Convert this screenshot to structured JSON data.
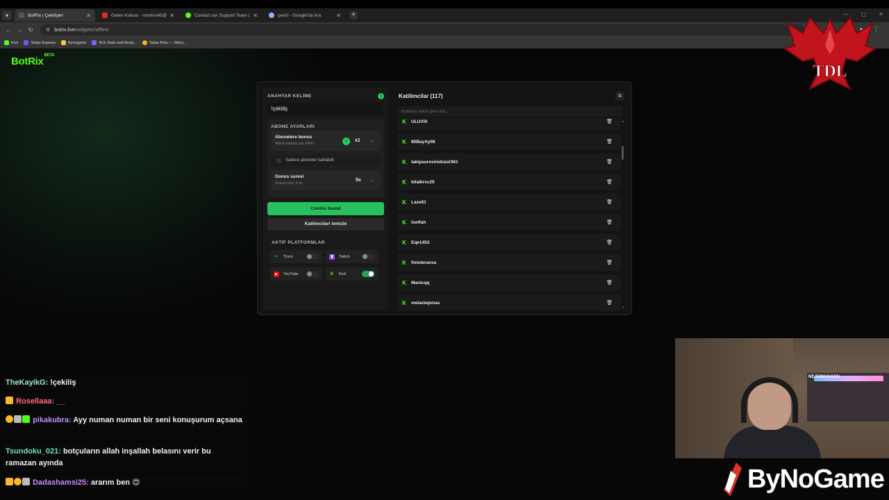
{
  "browser": {
    "tabs": [
      {
        "title": "BotRix | Çekilişler",
        "favicon_color": "#3a3a3a",
        "active": true
      },
      {
        "title": "Gelen Kutusu - nmnino45@gm",
        "favicon_color": "#d93025",
        "active": false
      },
      {
        "title": "Contact our Support Team | Ki",
        "favicon_color": "#53fc18",
        "active": false
      },
      {
        "title": "çeviri - Google'da Ara",
        "favicon_color": "#8ab4f8",
        "active": false
      }
    ],
    "url_host": "botrix.live",
    "url_path": "/widgets/raffles/",
    "bookmarks": [
      {
        "label": "Kick",
        "color": "#53fc18"
      },
      {
        "label": "Stripe Express",
        "color": "#635bff"
      },
      {
        "label": "Bynogame",
        "color": "#f5c542"
      },
      {
        "label": "Kick Stats and Analy...",
        "color": "#7b61ff"
      },
      {
        "label": "Takas Botu — Skins...",
        "color": "#f2b01e"
      }
    ]
  },
  "app": {
    "logo": "BotRix",
    "logo_badge": "BETA"
  },
  "raffle": {
    "keyword_label": "ANAHTAR KELİME",
    "keyword_value": "!çekiliş",
    "subscriber_section": "ABONE AYARLARI",
    "sub_bonus_title": "Abonelere bonus",
    "sub_bonus_sub": "Abone bonusu yok (OFF)",
    "sub_bonus_mult": "x1",
    "subs_only": "Sadece aboneler katilabilir",
    "duration_title": "Donus suresi",
    "duration_sub": "Guncel sure: 5 sn",
    "duration_value": "5s",
    "start_button": "Cekilisi baslat",
    "clear_button": "Katilimcilari temizle",
    "platforms_label": "AKTİF PLATFORMLAR",
    "platforms": [
      {
        "name": "Trovo",
        "enabled": false,
        "color": "#1db954"
      },
      {
        "name": "Twitch",
        "enabled": false,
        "color": "#9146ff"
      },
      {
        "name": "YouTube",
        "enabled": false,
        "color": "#ff0000"
      },
      {
        "name": "Kick",
        "enabled": true,
        "color": "#53fc18"
      }
    ]
  },
  "participants": {
    "header": "Katilimcilar (117)",
    "search_placeholder": "Kullanici adina gore ara...",
    "items": [
      "ULUVİ4",
      "80BayAy08",
      "takipsuresiniduzel361",
      "bilalkrsc25",
      "Laze61",
      "tsetfah",
      "Eqe1453",
      "fixtoleranss",
      "Manicqq",
      "melaniejonas"
    ]
  },
  "chat": [
    {
      "user": "TheKayikG",
      "user_color": "#9ee6c8",
      "text": "!çekiliş",
      "badges": []
    },
    {
      "user": "Rosellaaa",
      "user_color": "#ff6f7f",
      "text": "__",
      "badges": [
        "#f5b82e"
      ]
    },
    {
      "user": "pikakubra",
      "user_color": "#c58cff",
      "text": "Ayy numan numan bir seni konuşurum açsana",
      "badges": [
        "#f5b82e",
        "#bbbbbb",
        "#53fc18"
      ]
    },
    {
      "user": "Tsundoku_021",
      "user_color": "#6fe0c4",
      "text": "botçuların allah inşallah belasını verir bu ramazan ayında",
      "badges": []
    },
    {
      "user": "Dadashamsi25",
      "user_color": "#c58cff",
      "text": "ararım ben 😍",
      "badges": [
        "#f5b82e",
        "#f5b82e",
        "#bbbbbb"
      ]
    }
  ],
  "overlay": {
    "brand": "ByNoGame",
    "crest_text": "TDL",
    "webcam_led_text": "NE EMNUHAEN"
  }
}
